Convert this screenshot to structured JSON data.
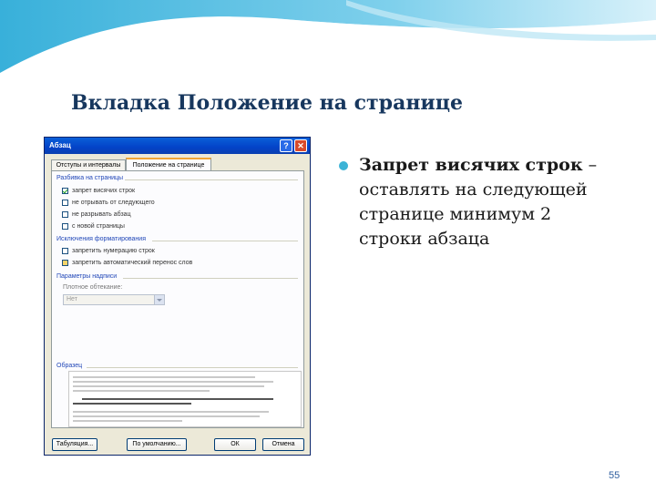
{
  "slide": {
    "title": "Вкладка Положение на странице",
    "bullet_bold": "Запрет висячих строк",
    "bullet_rest": " – оставлять на следующей странице минимум 2 строки абзаца",
    "page_number": "55"
  },
  "dialog": {
    "title": "Абзац",
    "help_glyph": "?",
    "close_glyph": "✕",
    "tabs": [
      "Отступы и интервалы",
      "Положение на странице"
    ],
    "group_pagination": "Разбивка на страницы",
    "checkboxes_pagination": [
      {
        "label": "запрет висячих строк",
        "checked": true
      },
      {
        "label": "не отрывать от следующего",
        "checked": false
      },
      {
        "label": "не разрывать абзац",
        "checked": false
      },
      {
        "label": "с новой страницы",
        "checked": false
      }
    ],
    "group_formatting": "Исключения форматирования",
    "checkboxes_formatting": [
      {
        "label": "запретить нумерацию строк",
        "checked": false
      },
      {
        "label": "запретить автоматический перенос слов",
        "checked": false
      }
    ],
    "group_textbox": "Параметры надписи",
    "wrap_label": "Плотное обтекание:",
    "wrap_value": "Нет",
    "preview_label": "Образец",
    "buttons": {
      "tabs": "Табуляция...",
      "default": "По умолчанию...",
      "ok": "ОК",
      "cancel": "Отмена"
    }
  },
  "colors": {
    "title": "#17375e",
    "bullet": "#3cb3d6",
    "wave": "#5ec3e3"
  }
}
